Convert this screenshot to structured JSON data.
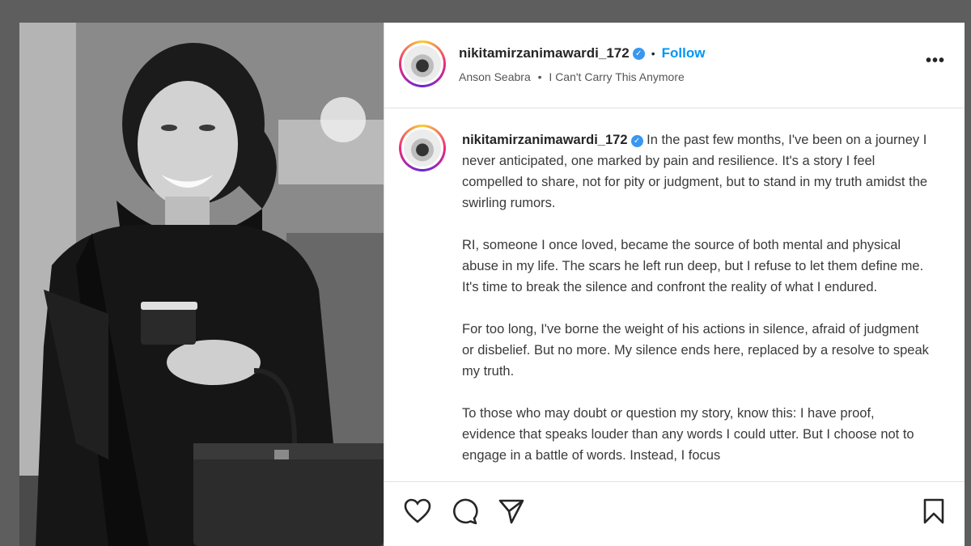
{
  "post": {
    "username": "nikitamirzanimawardi_172",
    "verified_mark": "✓",
    "separator": "•",
    "follow_label": "Follow",
    "audio_artist": "Anson Seabra",
    "audio_title": "I Can't Carry This Anymore",
    "more_label": "•••"
  },
  "caption": {
    "paragraphs": [
      "In the past few months, I've been on a journey I never anticipated, one marked by pain and resilience. It's a story I feel compelled to share, not for pity or judgment, but to stand in my truth amidst the swirling rumors.",
      "RI, someone I once loved, became the source of both mental and physical abuse in my life. The scars he left run deep, but I refuse to let them define me. It's time to break the silence and confront the reality of what I endured.",
      "For too long, I've borne the weight of his actions in silence, afraid of judgment or disbelief. But no more. My silence ends here, replaced by a resolve to speak my truth.",
      "To those who may doubt or question my story, know this: I have proof, evidence that speaks louder than any words I could utter. But I choose not to engage in a battle of words. Instead, I focus"
    ]
  },
  "icons": {
    "like": "heart-icon",
    "comment": "comment-icon",
    "share": "share-icon",
    "save": "bookmark-icon",
    "more": "more-options-icon"
  },
  "colors": {
    "follow": "#0095f6",
    "verified": "#3897f0",
    "backdrop": "#5e5e5e"
  }
}
